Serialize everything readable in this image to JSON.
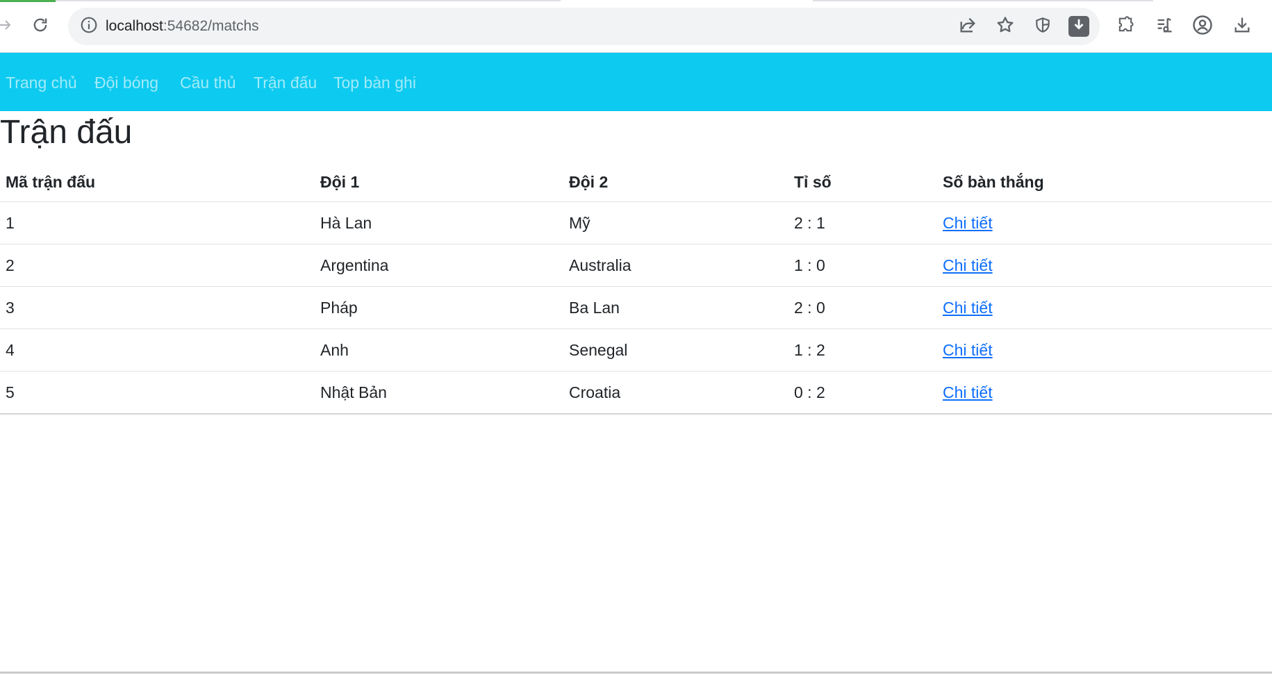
{
  "browser": {
    "url_host": "localhost",
    "url_path": ":54682/matchs"
  },
  "icons": {
    "forward": "arrow-right-icon",
    "reload": "reload-icon",
    "site_info": "info-icon",
    "share": "share-icon",
    "bookmark": "star-icon",
    "shield": "shield-icon",
    "ext_download": "download-extension-icon",
    "extensions": "puzzle-icon",
    "media": "media-playlist-icon",
    "profile": "profile-icon",
    "downloads": "download-icon"
  },
  "navbar": {
    "background": "#0dcaf0",
    "links": [
      "Trang chủ",
      "Đội bóng",
      "Cầu thủ",
      "Trận đấu",
      "Top bàn ghi"
    ]
  },
  "page": {
    "title": "Trận đấu"
  },
  "table": {
    "headers": [
      "Mã trận đấu",
      "Đội 1",
      "Đội 2",
      "Tỉ số",
      "Số bàn thắng"
    ],
    "rows": [
      {
        "id": "1",
        "team1": "Hà Lan",
        "team2": "Mỹ",
        "score": "2 : 1",
        "link": "Chi tiết"
      },
      {
        "id": "2",
        "team1": "Argentina",
        "team2": "Australia",
        "score": "1 : 0",
        "link": "Chi tiết"
      },
      {
        "id": "3",
        "team1": "Pháp",
        "team2": "Ba Lan",
        "score": "2 : 0",
        "link": "Chi tiết"
      },
      {
        "id": "4",
        "team1": "Anh",
        "team2": "Senegal",
        "score": "1 : 2",
        "link": "Chi tiết"
      },
      {
        "id": "5",
        "team1": "Nhật Bản",
        "team2": "Croatia",
        "score": "0 : 2",
        "link": "Chi tiết"
      }
    ]
  },
  "colors": {
    "link": "#0d6efd",
    "text": "#212529"
  }
}
